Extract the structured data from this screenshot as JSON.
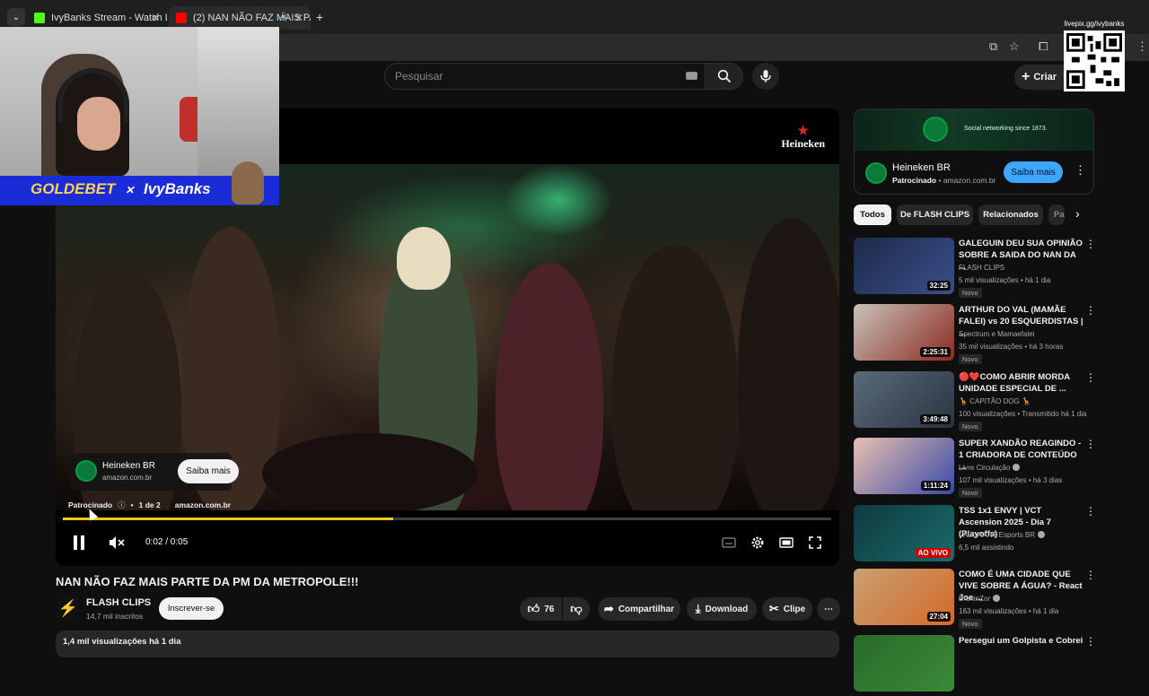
{
  "browser": {
    "tabs": [
      {
        "label": "IvyBanks Stream - Watch Live o",
        "favicon_color": "#53fc18",
        "active": false
      },
      {
        "label": "(2) NAN NÃO FAZ MAIS PA",
        "favicon_color": "#ff0000",
        "active": true
      }
    ],
    "new_tab": "+",
    "close": "✕"
  },
  "header": {
    "search_placeholder": "Pesquisar",
    "create_label": "Criar"
  },
  "player": {
    "brand_overlay": "Heineken",
    "ad_card": {
      "title": "Heineken BR",
      "url": "amazon.com.br",
      "cta": "Saiba mais"
    },
    "ad_info": {
      "sponsored": "Patrocinado",
      "position": "1 de 2",
      "url": "amazon.com.br"
    },
    "progress": 0.43,
    "time": "0:02 / 0:05"
  },
  "video": {
    "title": "NAN NÃO FAZ MAIS PARTE DA PM DA METROPOLE!!!",
    "channel": "FLASH CLIPS",
    "subscribers": "14,7 mil inscritos",
    "subscribe_label": "Inscrever-se",
    "likes": "76",
    "share_label": "Compartilhar",
    "download_label": "Download",
    "clip_label": "Clipe",
    "description_meta": "1,4 mil visualizações  há 1 dia"
  },
  "side_ad": {
    "banner_tagline": "Social networking since 1873.",
    "title": "Heineken BR",
    "sponsored": "Patrocinado",
    "url": "amazon.com.br",
    "cta": "Saiba mais"
  },
  "chips": [
    "Todos",
    "De FLASH CLIPS",
    "Relacionados",
    "Pa"
  ],
  "recommended": [
    {
      "title": "GALEGUIN DEU SUA OPINIÃO SOBRE A SAIDA DO NAN DA ...",
      "channel": "FLASH CLIPS",
      "verified": false,
      "meta": "5 mil visualizações • há 1 dia",
      "badge": "Novo",
      "duration": "32:25",
      "live": false,
      "thumb_colors": [
        "#1d2a4a",
        "#3a4f8a"
      ]
    },
    {
      "title": "ARTHUR DO VAL (MAMÃE FALEI) vs 20 ESQUERDISTAS | ...",
      "channel": "Spectrum e Mamaefalei",
      "verified": false,
      "meta": "35 mil visualizações • há 3 horas",
      "badge": "Novo",
      "duration": "2:25:31",
      "live": false,
      "thumb_colors": [
        "#c9c2b8",
        "#8a2a22"
      ]
    },
    {
      "title": "🔴❤️COMO ABRIR MORDA UNIDADE ESPECIAL DE ...",
      "channel": "🦒 CAPITÃO DOG 🦒",
      "verified": false,
      "meta": "100 visualizações • Transmitido há 1 dia",
      "badge": "Novo",
      "duration": "3:49:48",
      "live": false,
      "thumb_colors": [
        "#5a6a7a",
        "#2a3440"
      ]
    },
    {
      "title": "SUPER XANDÃO REAGINDO - 1 CRIADORA DE CONTEÚDO ...",
      "channel": "Livre Circulação",
      "verified": true,
      "meta": "107 mil visualizações • há 3 dias",
      "badge": "Novo",
      "duration": "1:11:24",
      "live": false,
      "thumb_colors": [
        "#e8c0b0",
        "#3a4aa8"
      ]
    },
    {
      "title": "TSS 1x1 ENVY | VCT Ascension 2025 - Dia 7 (Playoffs)",
      "channel": "VALORANT Esports BR",
      "verified": true,
      "meta": "6,5 mil assistindo",
      "badge": "",
      "duration": "AO VIVO",
      "live": true,
      "thumb_colors": [
        "#0e3a40",
        "#1a6a6a"
      ]
    },
    {
      "title": "COMO É UMA CIDADE QUE VIVE SOBRE A ÁGUA? - React Joe ...",
      "channel": "BruninZor",
      "verified": true,
      "meta": "163 mil visualizações • há 1 dia",
      "badge": "Novo",
      "duration": "27:04",
      "live": false,
      "thumb_colors": [
        "#c9a070",
        "#d46a2a"
      ]
    },
    {
      "title": "Persegui um Golpista e Cobrei",
      "channel": "",
      "verified": false,
      "meta": "",
      "badge": "",
      "duration": "",
      "live": false,
      "thumb_colors": [
        "#2a6a2a",
        "#3a8a3a"
      ]
    }
  ],
  "stream_overlay": {
    "banner_sponsor": "GOLDEBET",
    "banner_sep": "✕",
    "banner_streamer": "IvyBanks",
    "qr_label": "livepix.gg/ivybanks"
  },
  "icons": {
    "search": "search-icon",
    "mic": "mic-icon",
    "play_pause": "pause-icon",
    "mute": "mute-icon",
    "settings": "gear-icon",
    "fullscreen": "fullscreen-icon"
  }
}
